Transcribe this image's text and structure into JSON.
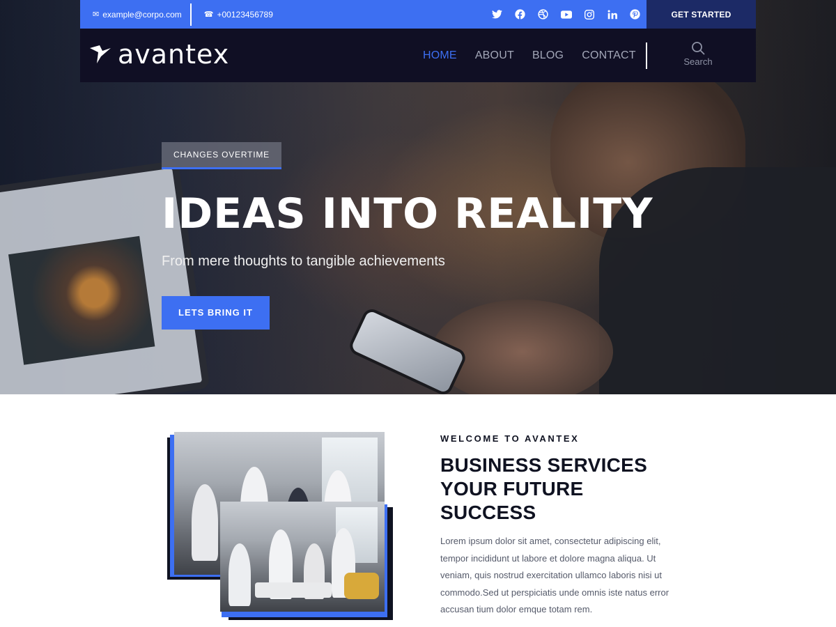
{
  "topbar": {
    "email": "example@corpo.com",
    "phone": "+00123456789",
    "socials": [
      "twitter-icon",
      "facebook-icon",
      "dribbble-icon",
      "youtube-icon",
      "instagram-icon",
      "linkedin-icon",
      "pinterest-icon"
    ],
    "get_started_label": "GET STARTED"
  },
  "navbar": {
    "logo_text": "avantex",
    "nav_items": [
      "HOME",
      "ABOUT",
      "BLOG",
      "CONTACT"
    ],
    "active_item": "HOME",
    "search_label": "Search"
  },
  "hero": {
    "eyebrow": "CHANGES OVERTIME",
    "title": "IDEAS INTO REALITY",
    "subtitle": "From mere thoughts to tangible achievements",
    "cta_label": "LETS BRING IT"
  },
  "about": {
    "eyebrow": "WELCOME TO AVANTEX",
    "title_lines": [
      "BUSINESS SERVICES",
      "YOUR FUTURE",
      "SUCCESS"
    ],
    "body": "Lorem ipsum dolor sit amet, consectetur adipiscing elit, tempor incididunt ut labore et dolore magna aliqua. Ut veniam, quis nostrud exercitation ullamco laboris nisi ut commodo.Sed ut perspiciatis unde omnis iste natus error accusan tium dolor emque totam rem."
  },
  "colors": {
    "accent": "#3d6ff2",
    "navy": "#100f24",
    "dark_button": "#1c2a66"
  }
}
